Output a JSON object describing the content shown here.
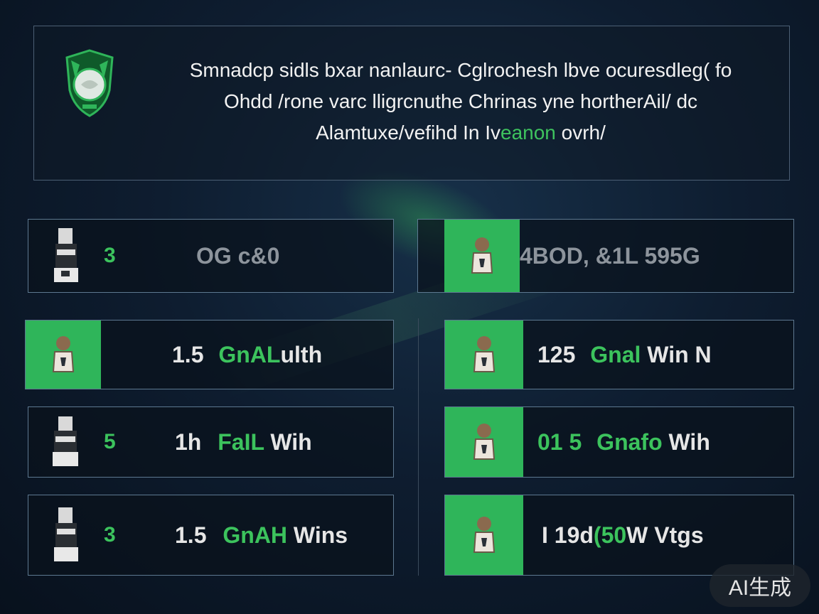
{
  "header": {
    "line1": "Smnadcp sidls bxar nanlaurc- Cglrochesh lbve ocuresdleg( fo",
    "line2": "Ohdd /rone varc lligrcnuthe Chrinas yne hortherAil/ dc",
    "line3_pre": "Alamtuxe/vefihd In Iv",
    "line3_highlight": "eanon",
    "line3_post": " ovrh/"
  },
  "cards": [
    {
      "rank": "3",
      "text_num": "",
      "text_green": "",
      "text_white": "OG c&0",
      "style": "gray",
      "thumb": "dark"
    },
    {
      "rank": "",
      "text_num": "4BOD, &1L 595G",
      "text_green": "",
      "text_white": "",
      "style": "gray",
      "thumb": "green"
    },
    {
      "rank": "",
      "text_num": "1.5",
      "text_green": "GnAL",
      "text_white": "ulth",
      "style": "normal",
      "thumb": "green"
    },
    {
      "rank": "",
      "text_num": "125",
      "text_green": "Gnal",
      "text_white": "Win N",
      "style": "normal",
      "thumb": "green"
    },
    {
      "rank": "5",
      "text_num": "1h",
      "text_green": "FaIL",
      "text_white": "Wih",
      "style": "normal",
      "thumb": "dark"
    },
    {
      "rank": "",
      "text_num": "01 5",
      "text_green": "Gnafo",
      "text_white": "Wih",
      "style": "normal",
      "thumb": "green"
    },
    {
      "rank": "3",
      "text_num": "1.5",
      "text_green": "GnAH",
      "text_white": "Wins",
      "style": "normal",
      "thumb": "dark"
    },
    {
      "rank": "",
      "text_num": "I 19d",
      "text_green": "(50",
      "text_white": "W Vtgs",
      "style": "normal",
      "thumb": "green"
    }
  ],
  "badge": "AI生成",
  "colors": {
    "accent": "#3cc35d",
    "tile": "#2fb55a",
    "border": "#5d7890"
  }
}
